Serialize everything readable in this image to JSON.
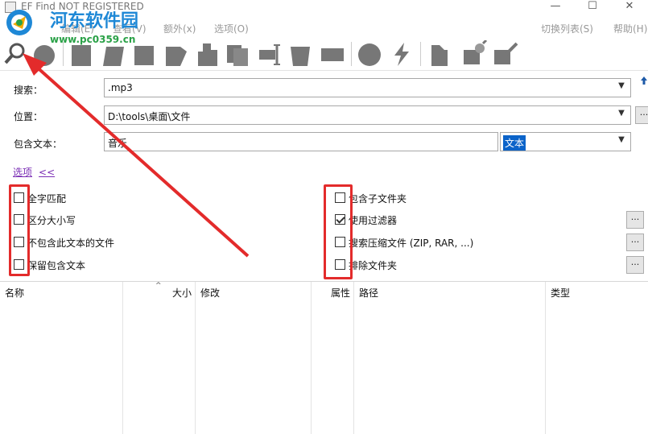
{
  "window": {
    "title": "EF Find NOT REGISTERED",
    "minimize": "—",
    "maximize": "☐",
    "close": "✕"
  },
  "watermark": {
    "name": "河东软件园",
    "url": "www.pc0359.cn"
  },
  "menu": {
    "items": [
      "编辑(E)",
      "查看(V)",
      "额外(x)",
      "选项(O)"
    ],
    "right": [
      "切换列表(S)",
      "帮助(H)"
    ]
  },
  "toolbar": {
    "buttons": [
      "search-icon",
      "stop-icon",
      "new-file-icon",
      "open-file-icon",
      "save-icon",
      "edit-icon",
      "copy-icon",
      "duplicate-icon",
      "move-icon",
      "delete-icon",
      "rename-icon",
      "properties-icon",
      "flash-icon",
      "bookmark-icon",
      "plugin-icon",
      "tools-icon"
    ]
  },
  "form": {
    "search_label": "搜索：",
    "search_value": ".mp3",
    "location_label": "位置：",
    "location_value": "D:\\tools\\桌面\\文件",
    "location_browse": "...",
    "text_label": "包含文本：",
    "text_value": "音乐",
    "text_mode": "文本",
    "options_link": "选项",
    "options_chevron": "<<"
  },
  "checkboxes": {
    "left": [
      {
        "label": "全字匹配",
        "checked": false
      },
      {
        "label": "区分大小写",
        "checked": false
      },
      {
        "label": "不包含此文本的文件",
        "checked": false
      },
      {
        "label": "保留包含文本",
        "checked": false
      }
    ],
    "right": [
      {
        "label": "包含子文件夹",
        "checked": false
      },
      {
        "label": "使用过滤器",
        "checked": true
      },
      {
        "label": "搜索压缩文件 (ZIP, RAR, ...)",
        "checked": false
      },
      {
        "label": "排除文件夹",
        "checked": false
      }
    ],
    "more_label": "..."
  },
  "results": {
    "columns": [
      "名称",
      "大小",
      "修改",
      "属性",
      "路径",
      "类型"
    ]
  },
  "colors": {
    "annotation": "#e32b2b",
    "selection": "#0b63c9",
    "watermark_blue": "#1e88d6",
    "watermark_green": "#2aa147"
  }
}
